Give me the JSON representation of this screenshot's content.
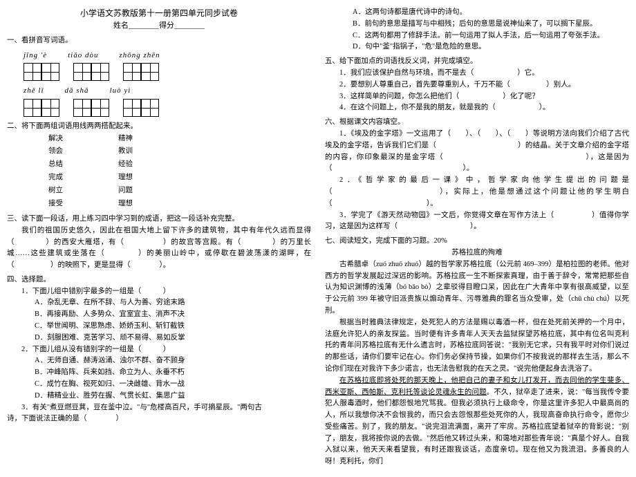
{
  "header": {
    "title": "小学语文苏教版第十一册第四单元同步试卷",
    "nameScore": "姓名________得分________"
  },
  "q1": {
    "label": "一、看拼音写词语。",
    "row1": [
      "jǐng 'è",
      "tiǎo dòu",
      "zhōng zhēn"
    ],
    "row2": [
      "zhě lǐ",
      "dǎ shǎ",
      "luò yì"
    ]
  },
  "q2": {
    "label": "二、将下面两组词语用线两两搭配起来。",
    "left": [
      "解决",
      "领会",
      "总结",
      "完成",
      "树立",
      "接受"
    ],
    "right": [
      "精神",
      "教训",
      "经验",
      "理想",
      "问题",
      "理想"
    ]
  },
  "q3": {
    "label": "三、读下面一段话，用上练习四中学习到的成语，把这一段话补充完整。",
    "text": "我们的祖国历史悠久，因此在祖国大地上留下许多的建筑物，其中有年代久远而显得（　　　　）的西安大雁塔，有（　　　　　）的故宫等宫殿。有（　　　　）的万里长城……这些建筑或坐落在（　　　　）的美丽山岭中，或停歇在碧波荡漾的湖畔，在（　　　　　）的映照下，更是显得（　　　　）。"
  },
  "q4": {
    "label": "四、选择题。",
    "sub1": {
      "stem": "1．下面儿组中错别字最多的一组是（　　　）",
      "a": "A．杂乱无章、在所不辞、与人为善、穷途末路",
      "b": "B．再接再励、人多势众、宜室宜主、消声不决",
      "c": "C．举世闻明、深思熟虑、娇娇玉利、斩钉截铁",
      "d": "D．刻服困难、克苦学习、顽不易得、易如反掌"
    },
    "sub2": {
      "stem": "2．下面儿组从没有错别字的一组是（　　　）",
      "a": "A．无师自通、赫涛汹涌、浊尔不群、奋不顾身",
      "b": "B．冲峰陷阵、兵来如挡、命立为人、永垂不朽",
      "c": "C．成竹在胸、视死如归、一决雌雄、背水一战",
      "d": "D．精精业业、胜劳在握、气贯长虹、集思广益"
    },
    "sub3": {
      "stem": "3．有关\"煮豆燃豆萁，豆在釜中泣。\"与\"危楼高百尺，手可摘星辰。\"两句古",
      "cont": "诗，下面说法正确的是（　　　　）"
    }
  },
  "q4opts": {
    "a": "A．这两句诗都是唐代诗中的诗句。",
    "b": "B．前句的意思是描写与中相残；后句的意思是说神仙来了，可以搁下星辰。",
    "c": "C．这两句都用了修辞手法。前一句运用了拟人手法，后一句运用了夸张手法。",
    "d": "D．句中\"釜\"指锅子，\"危\"是危险的意思。"
  },
  "q5": {
    "label": "五、给下面加点的词语找反义词，并完成填空。",
    "items": [
      "1．我们应该保护自然与环境，而不是去（　　　　　　）它。",
      "2．要想别人尊重自己，首先要尊重别人，千万不能（　　　　　）别人。",
      "3．这样简单的问题，你怎么把他们（　　　　　　）化了呢？",
      "4．在这个问题上，你不是我的朋友，就是我的（　　　　　　）。"
    ]
  },
  "q6": {
    "label": "六、根据课文内容填空。",
    "items": [
      "1．《埃及的金字塔》一文运用了（　　）、（　　）、（　　）等说明方法向我们介绍了古代埃及的金字塔，告诉我们它们是（　　　　　　　　　　　）的结晶。关于文章介绍的金字塔的内容，你印象最深的是金字塔（　　　　　　　　　　　　　　　　　　），这是因为（　　　　　　　　　　　　　　　　　　）。",
      "2．《哲学家的最后一课》中，哲学家向他学生提出的问题是（　　　　　　　　　　　　），实际上，他是想通过这个问题让他的学生明白（　　　　　　　　　　　　　）。",
      "3．学完了《游天然动物园》一文后，你觉得文章在写作方法上（　　　　　）值得你学习，这是因为这样写（　　　　　　　　　　）。"
    ]
  },
  "q7": {
    "label": "七、阅读短文，完成下面的习题。20%",
    "title": "苏格拉底的殉难",
    "p1": "古希腊卓（zuó zhuō zhuó）越的哲学家苏格拉底（公元前 469–399）是柏拉图的老师。他对西方的哲学发展起过深远的影响。苏格拉底一生不断探索真理，由于善于辞令，常常把那些自认为知识渊博的浅薄（bó bǎo bò）之辈驳得目瞪口呆，因此在广大青年中享有很高威望，以至于公元前 399 年被守旧派贵族以煽动青年、污辱雅典的罪名当众受审，处（chǔ chù chú）以死刑。",
    "p2": "根据当时雅典法律规定，处死犯人的方法是赐以毒酒一杯，但在处死前关押的一个月中，法庭允许犯人的亲友探监。当时便有许多青年人天天去监狱探望苏格拉底，其中有位名叫克利托的青年问苏格拉底有无什么遗言时，苏格拉底同答说：\"我别无它求，只有我平时对你们说过的那些话，请你们要牢记在心。你们务必保持节操，如果你们不按我说的那样去生活，那么不论你们现在对我许下多少诺言，也无法告慰我的在天之灵。\"说完他便起身去洗浴了。",
    "p3_u": "在苏格拉底即将处死的那天晚上，他把自己的妻子和女儿打发开，而去同他的学生斐多、西米亚斯、西帕斯、克利托等谈论灵魂永生的问题",
    "p3_rest": "。不久，狱卒走了进来，说：\"每当我传令要犯人服毒酒时，他们都怨恨地咒骂我。但我必须执行上级命令，你是这里许多犯人中最高尚的人，所以我想你决不会恨我的，而只会去怨恨那些处死你的人，我现高奋命执行命令，愿你少受些痛苦。别了，我的朋友。\"说完泪流满面，离开了牢房。苏格拉底望着狱卒的背影说：\"别了，朋友，我将按你说的去做。\"然后他又转过头来，和蔼地对那些青年说：\"真是个好人。自我入狱以来，他天天来看望我，有时还跟我谈话，态度亲切。现在他又为我流泪。多善良的人呀！克利托，你们"
  }
}
